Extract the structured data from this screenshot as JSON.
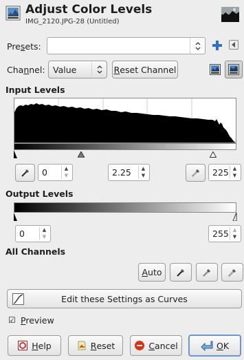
{
  "header": {
    "title": "Adjust Color Levels",
    "subtitle": "IMG_2120.JPG-28 (Untitled)"
  },
  "presets": {
    "label_pre": "Pre",
    "label_acc": "s",
    "label_post": "ets:",
    "value": ""
  },
  "channel": {
    "label_pre": "Cha",
    "label_acc": "n",
    "label_post": "nel:",
    "value": "Value",
    "reset_pre": "R",
    "reset_post": "eset Channel"
  },
  "input_levels": {
    "heading": "Input Levels",
    "low": "0",
    "gamma": "2.25",
    "high": "225",
    "gamma_marker_fraction": 0.33,
    "high_marker_fraction": 0.88
  },
  "output_levels": {
    "heading": "Output Levels",
    "low": "0",
    "high": "255"
  },
  "all_channels": {
    "heading": "All Channels",
    "auto_pre": "",
    "auto_acc": "A",
    "auto_post": "uto"
  },
  "curves_button": {
    "label": "Edit these Settings as Curves"
  },
  "preview": {
    "acc": "P",
    "rest": "review",
    "checked": true
  },
  "footer": {
    "help_acc": "H",
    "help_rest": "elp",
    "reset_acc": "R",
    "reset_rest": "eset",
    "cancel_acc": "C",
    "cancel_rest": "ancel",
    "ok_acc": "O",
    "ok_rest": "K"
  }
}
